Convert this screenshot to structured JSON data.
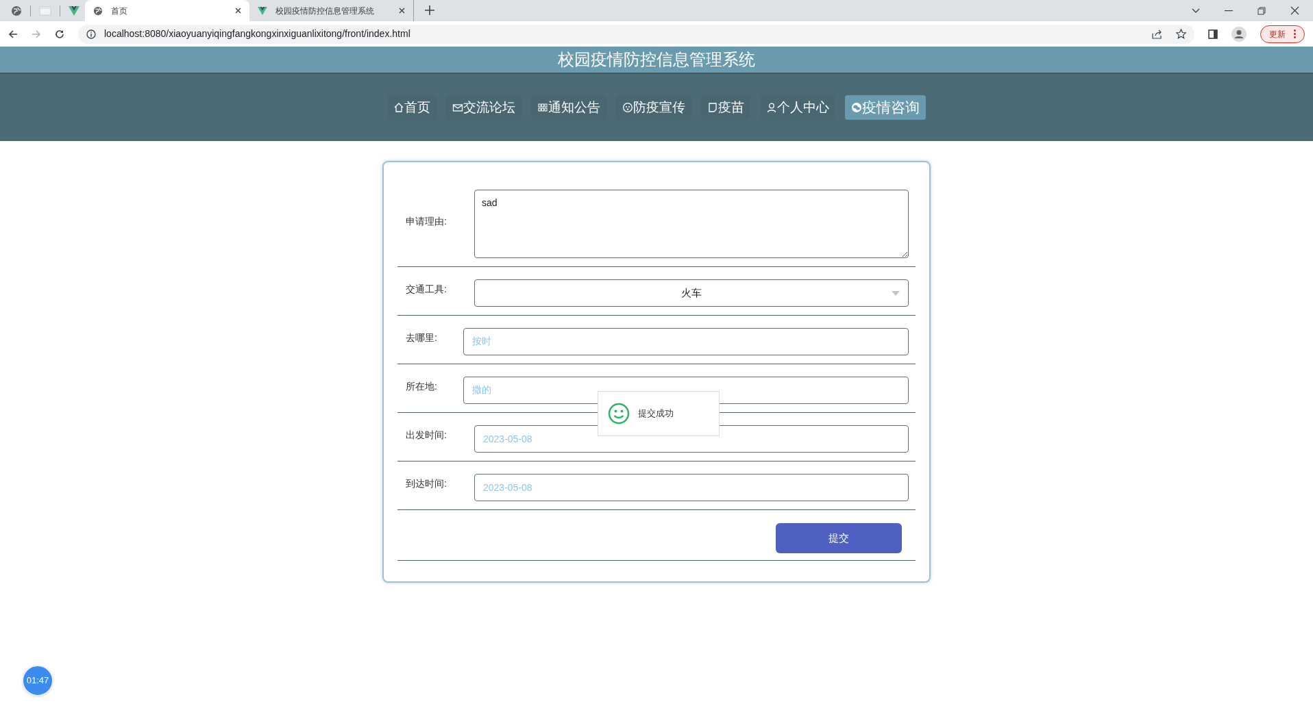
{
  "browser": {
    "tabs": [
      {
        "label": "首页",
        "selected": true,
        "kind": "globe"
      },
      {
        "label": "校园疫情防控信息管理系统",
        "selected": false,
        "kind": "vue"
      }
    ],
    "address": "localhost:8080/xiaoyuanyiqingfangkongxinxiguanlixitong/front/index.html",
    "update_button": "更新"
  },
  "header": {
    "title": "校园疫情防控信息管理系统"
  },
  "nav": [
    {
      "label": "首页",
      "kind": "home",
      "selected": false
    },
    {
      "label": "交流论坛",
      "kind": "mail",
      "selected": false
    },
    {
      "label": "通知公告",
      "kind": "grid",
      "selected": false
    },
    {
      "label": "防疫宣传",
      "kind": "face",
      "selected": false
    },
    {
      "label": "疫苗",
      "kind": "doc",
      "selected": false
    },
    {
      "label": "个人中心",
      "kind": "user",
      "selected": false
    },
    {
      "label": "疫情咨询",
      "kind": "chat",
      "selected": true
    }
  ],
  "form": {
    "fields": [
      {
        "label": "申请理由:",
        "kind": "textarea",
        "value": "sad"
      },
      {
        "label": "交通工具:",
        "kind": "select",
        "value": "火车"
      },
      {
        "label": "去哪里:",
        "kind": "text",
        "value": "按时"
      },
      {
        "label": "所在地:",
        "kind": "text",
        "value": "撒的"
      },
      {
        "label": "出发时间:",
        "kind": "date",
        "value": "2023-05-08"
      },
      {
        "label": "到达时间:",
        "kind": "date",
        "value": "2023-05-08"
      }
    ],
    "submit": "提交"
  },
  "toast": {
    "message": "提交成功"
  },
  "timer": "01:47"
}
